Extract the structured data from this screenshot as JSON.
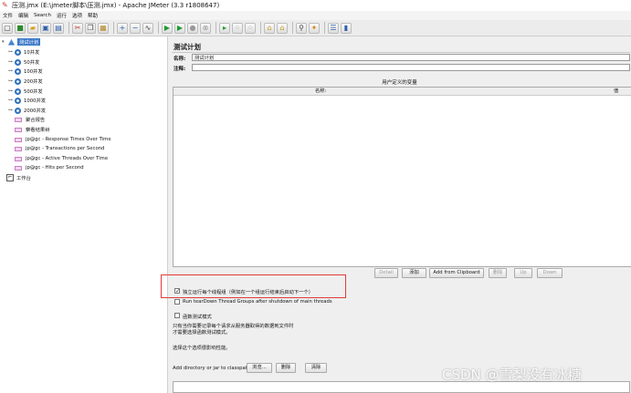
{
  "window": {
    "title": "压测.jmx (E:\\jmeter脚本\\压测.jmx) - Apache JMeter (3.3 r1808647)"
  },
  "menu": [
    "文件",
    "编辑",
    "Search",
    "运行",
    "选项",
    "帮助"
  ],
  "tree": {
    "test_plan": "测试计划",
    "items": [
      {
        "label": "10并发",
        "type": "thread-group"
      },
      {
        "label": "50并发",
        "type": "thread-group"
      },
      {
        "label": "100并发",
        "type": "thread-group"
      },
      {
        "label": "200并发",
        "type": "thread-group"
      },
      {
        "label": "500并发",
        "type": "thread-group"
      },
      {
        "label": "1000并发",
        "type": "thread-group"
      },
      {
        "label": "2000并发",
        "type": "thread-group"
      },
      {
        "label": "聚合报告",
        "type": "listener"
      },
      {
        "label": "察看结果树",
        "type": "listener"
      },
      {
        "label": "jp@gc - Response Times Over Time",
        "type": "listener"
      },
      {
        "label": "jp@gc - Transactions per Second",
        "type": "listener"
      },
      {
        "label": "jp@gc - Active Threads Over Time",
        "type": "listener"
      },
      {
        "label": "jp@gc - Hits per Second",
        "type": "listener"
      }
    ],
    "workbench": "工作台"
  },
  "panel": {
    "heading": "测试计划",
    "name_label": "名称:",
    "name_value": "测试计划",
    "comment_label": "注释:",
    "comment_value": "",
    "udv_title": "用户定义的变量",
    "col_name": "名称:",
    "col_value": "值"
  },
  "buttons": {
    "detail": "Detail",
    "add": "添加",
    "add_clipboard": "Add from Clipboard",
    "delete": "删除",
    "up": "Up",
    "down": "Down"
  },
  "options": {
    "serialize_label": "独立运行每个线程组（例如在一个组运行结束后启动下一个）",
    "serialize_checked": true,
    "teardown_label": "Run tearDown Thread Groups after shutdown of main threads",
    "teardown_checked": false,
    "functional_label": "函数测试模式",
    "functional_checked": false,
    "note1": "只有当你需要记录每个请求从服务器取得的数据到文件时",
    "note2": "才需要选择函数测试模式。",
    "note3": "选择这个选项很影响性能。"
  },
  "classpath": {
    "label": "Add directory or jar to classpath",
    "browse": "浏览...",
    "delete": "删除",
    "clear": "清除"
  },
  "watermark": "CSDN @雪梨没有冰糖"
}
